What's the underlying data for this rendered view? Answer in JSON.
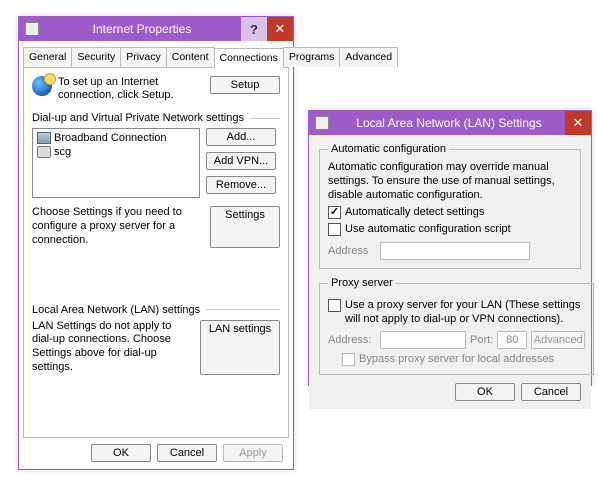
{
  "ip": {
    "title": "Internet Properties",
    "tabs": [
      "General",
      "Security",
      "Privacy",
      "Content",
      "Connections",
      "Programs",
      "Advanced"
    ],
    "active_tab_index": 4,
    "setup_text": "To set up an Internet connection, click Setup.",
    "setup_btn": "Setup",
    "dial_section": "Dial-up and Virtual Private Network settings",
    "connections": [
      {
        "name": "Broadband Connection",
        "icon": "screen"
      },
      {
        "name": "scg",
        "icon": "phone"
      }
    ],
    "add_btn": "Add...",
    "addvpn_btn": "Add VPN...",
    "remove_btn": "Remove...",
    "settings_text": "Choose Settings if you need to configure a proxy server for a connection.",
    "settings_btn": "Settings",
    "lan_section": "Local Area Network (LAN) settings",
    "lan_text": "LAN Settings do not apply to dial-up connections. Choose Settings above for dial-up settings.",
    "lan_btn": "LAN settings",
    "ok": "OK",
    "cancel": "Cancel",
    "apply": "Apply"
  },
  "lan": {
    "title": "Local Area Network (LAN) Settings",
    "auto_legend": "Automatic configuration",
    "auto_note": "Automatic configuration may override manual settings. To ensure the use of manual settings, disable automatic configuration.",
    "auto_detect": "Automatically detect settings",
    "auto_detect_checked": true,
    "use_script": "Use automatic configuration script",
    "use_script_checked": false,
    "address_label": "Address",
    "proxy_legend": "Proxy server",
    "use_proxy": "Use a proxy server for your LAN (These settings will not apply to dial-up or VPN connections).",
    "use_proxy_checked": false,
    "addr2_label": "Address:",
    "port_label": "Port:",
    "port_value": "80",
    "advanced": "Advanced",
    "bypass": "Bypass proxy server for local addresses",
    "bypass_checked": false,
    "ok": "OK",
    "cancel": "Cancel"
  }
}
